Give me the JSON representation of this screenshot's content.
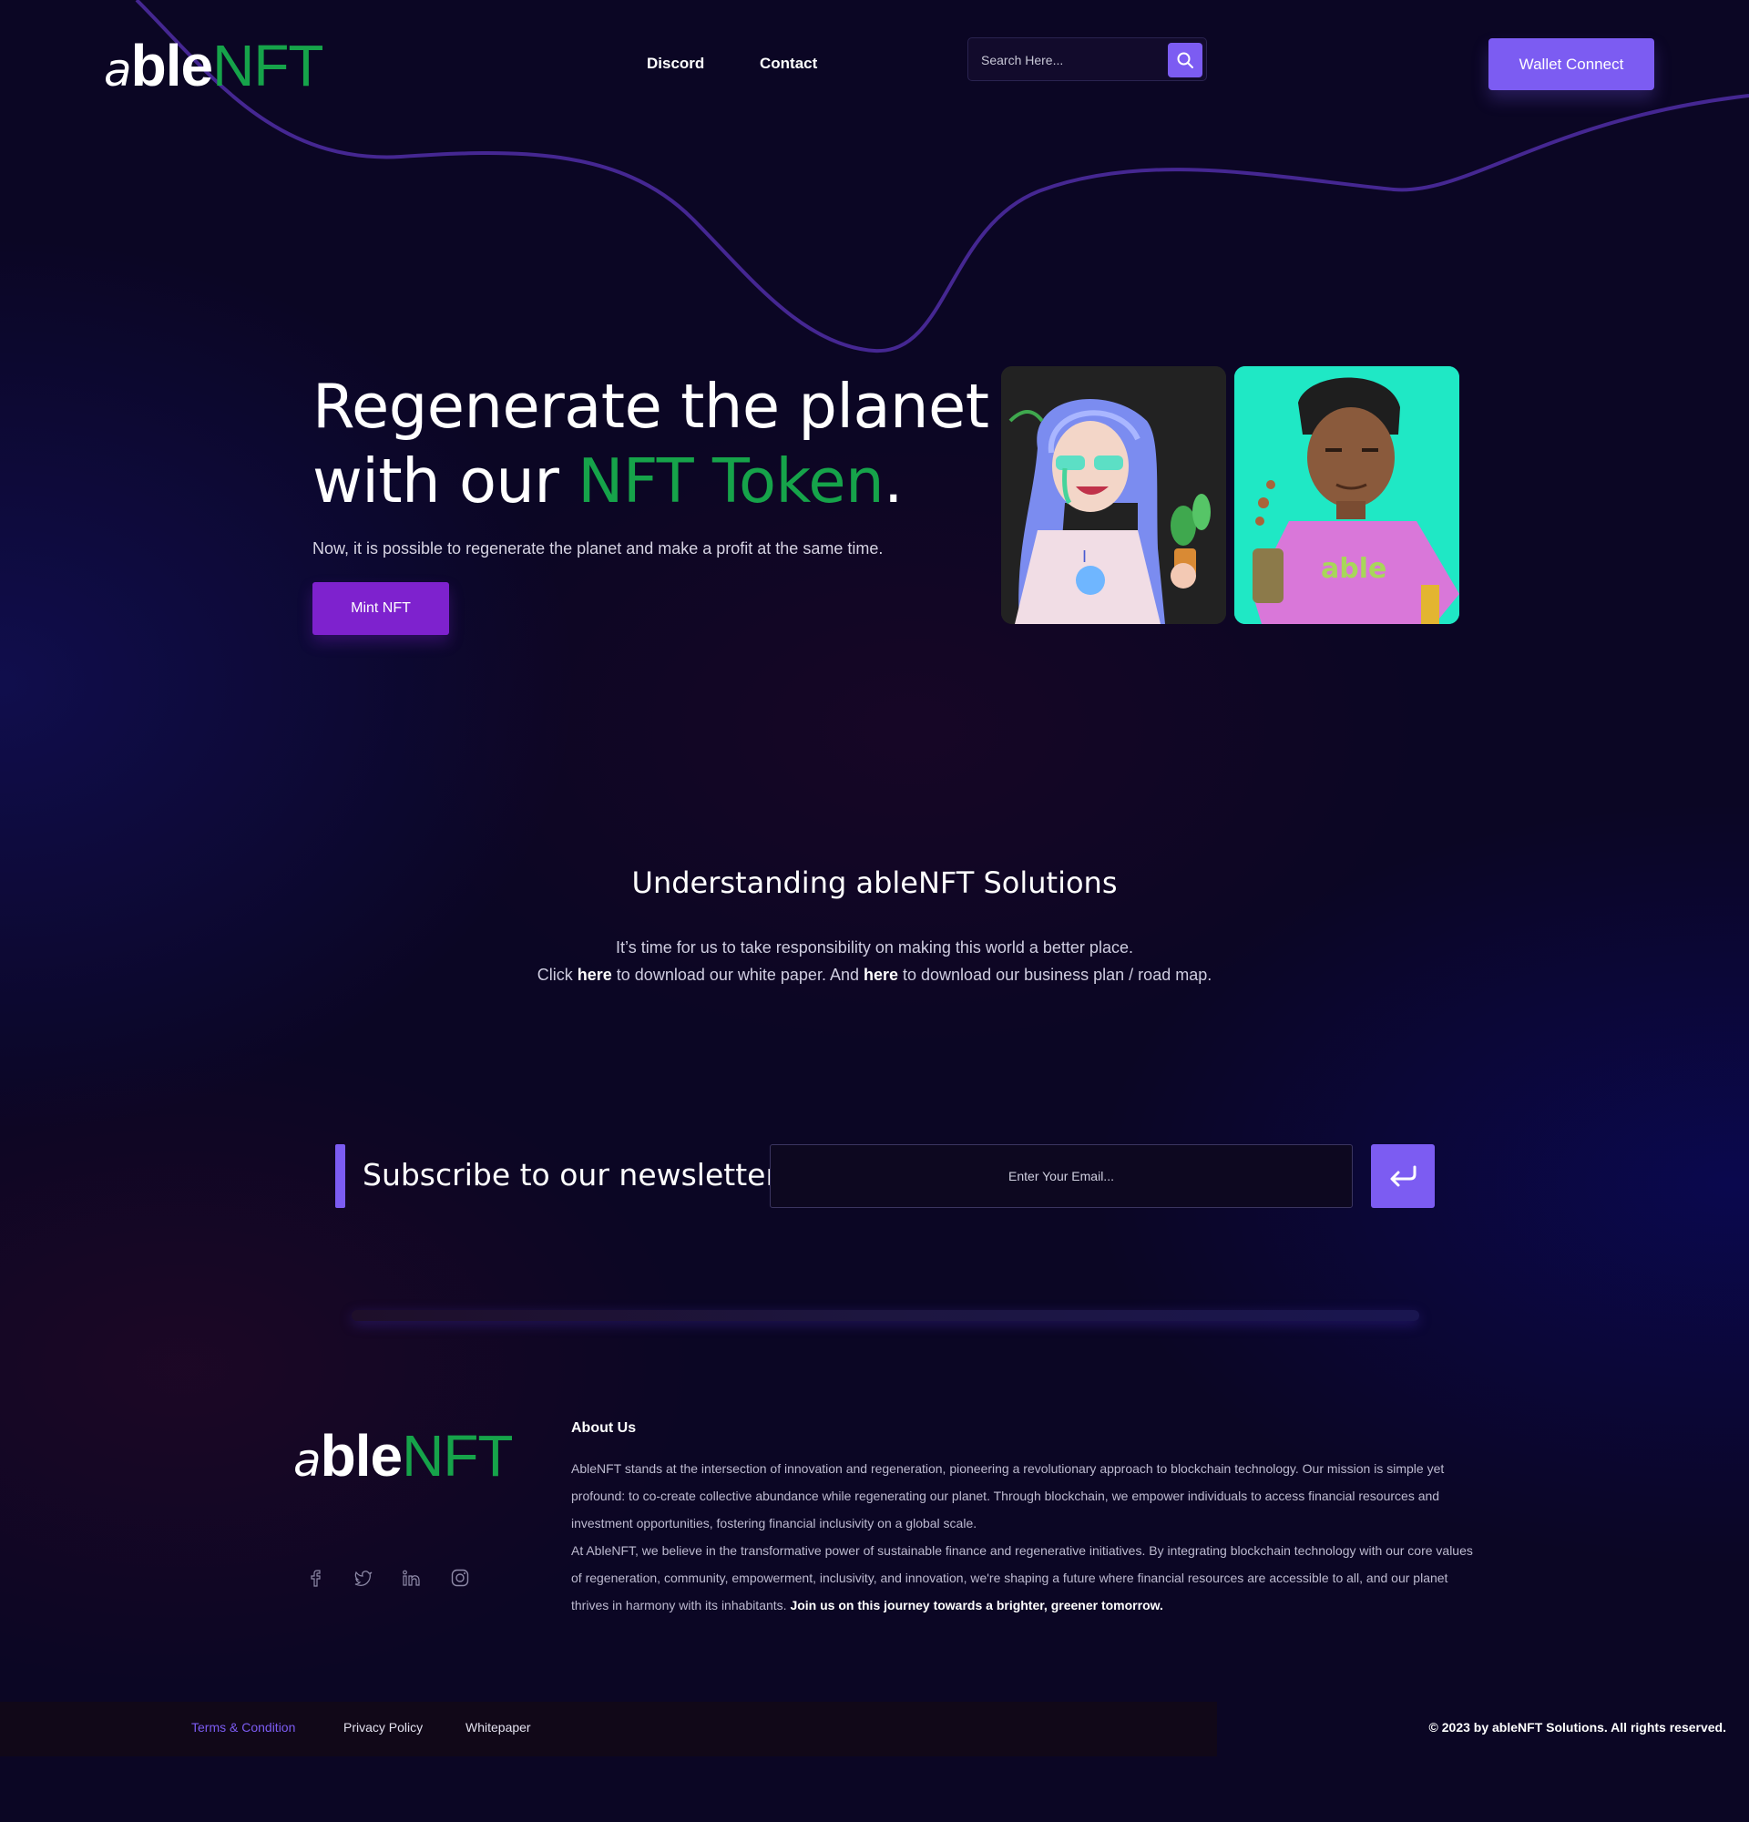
{
  "brand": {
    "logo_a": "a",
    "logo_ble": "ble",
    "logo_nft": "NFT",
    "accent_green": "#16a34a",
    "accent_purple": "#7c5cf2"
  },
  "header": {
    "nav": [
      {
        "label": "Discord"
      },
      {
        "label": "Contact"
      }
    ],
    "search": {
      "placeholder": "Search Here...",
      "icon": "search-icon"
    },
    "wallet_button": "Wallet Connect"
  },
  "hero": {
    "title_line1": "Regenerate the planet",
    "title_line2_prefix": "with our ",
    "title_highlight": "NFT Token",
    "title_suffix": ".",
    "subtitle": "Now, it is possible to regenerate the planet and make a profit at the same time.",
    "cta": "Mint NFT",
    "cards": [
      {
        "name": "nft-girl-card",
        "bg": "#222222"
      },
      {
        "name": "nft-boy-card",
        "bg": "#1fe8c5"
      }
    ]
  },
  "understanding": {
    "title": "Understanding ableNFT Solutions",
    "line1": "It’s time for us to take responsibility on making this world a better place.",
    "line2_part1": "Click ",
    "link1": "here",
    "line2_part2": " to download our white paper. And ",
    "link2": "here",
    "line2_part3": " to download our business plan / road map."
  },
  "newsletter": {
    "label": "Subscribe to our newsletter:",
    "placeholder": "Enter Your Email...",
    "submit_icon": "enter-arrow-icon"
  },
  "footer": {
    "about_title": "About Us",
    "about_p1": "AbleNFT stands at the intersection of innovation and regeneration, pioneering a revolutionary approach to blockchain technology. Our mission is simple yet profound: to co-create collective abundance while regenerating our planet. Through blockchain, we empower individuals to access financial resources and investment opportunities, fostering financial inclusivity on a global scale.",
    "about_p2": "At AbleNFT, we believe in the transformative power of sustainable finance and regenerative initiatives. By integrating blockchain technology with our core values of regeneration, community, empowerment, inclusivity, and innovation, we're shaping a future where financial resources are accessible to all, and our planet thrives in harmony with its inhabitants. ",
    "about_p2_bold": "Join us on this journey towards a brighter, greener tomorrow.",
    "socials": [
      "facebook-icon",
      "twitter-icon",
      "linkedin-icon",
      "instagram-icon"
    ],
    "links": [
      "Terms & Condition",
      "Privacy Policy",
      "Whitepaper"
    ],
    "copyright": "© 2023 by ableNFT Solutions. All rights reserved."
  }
}
